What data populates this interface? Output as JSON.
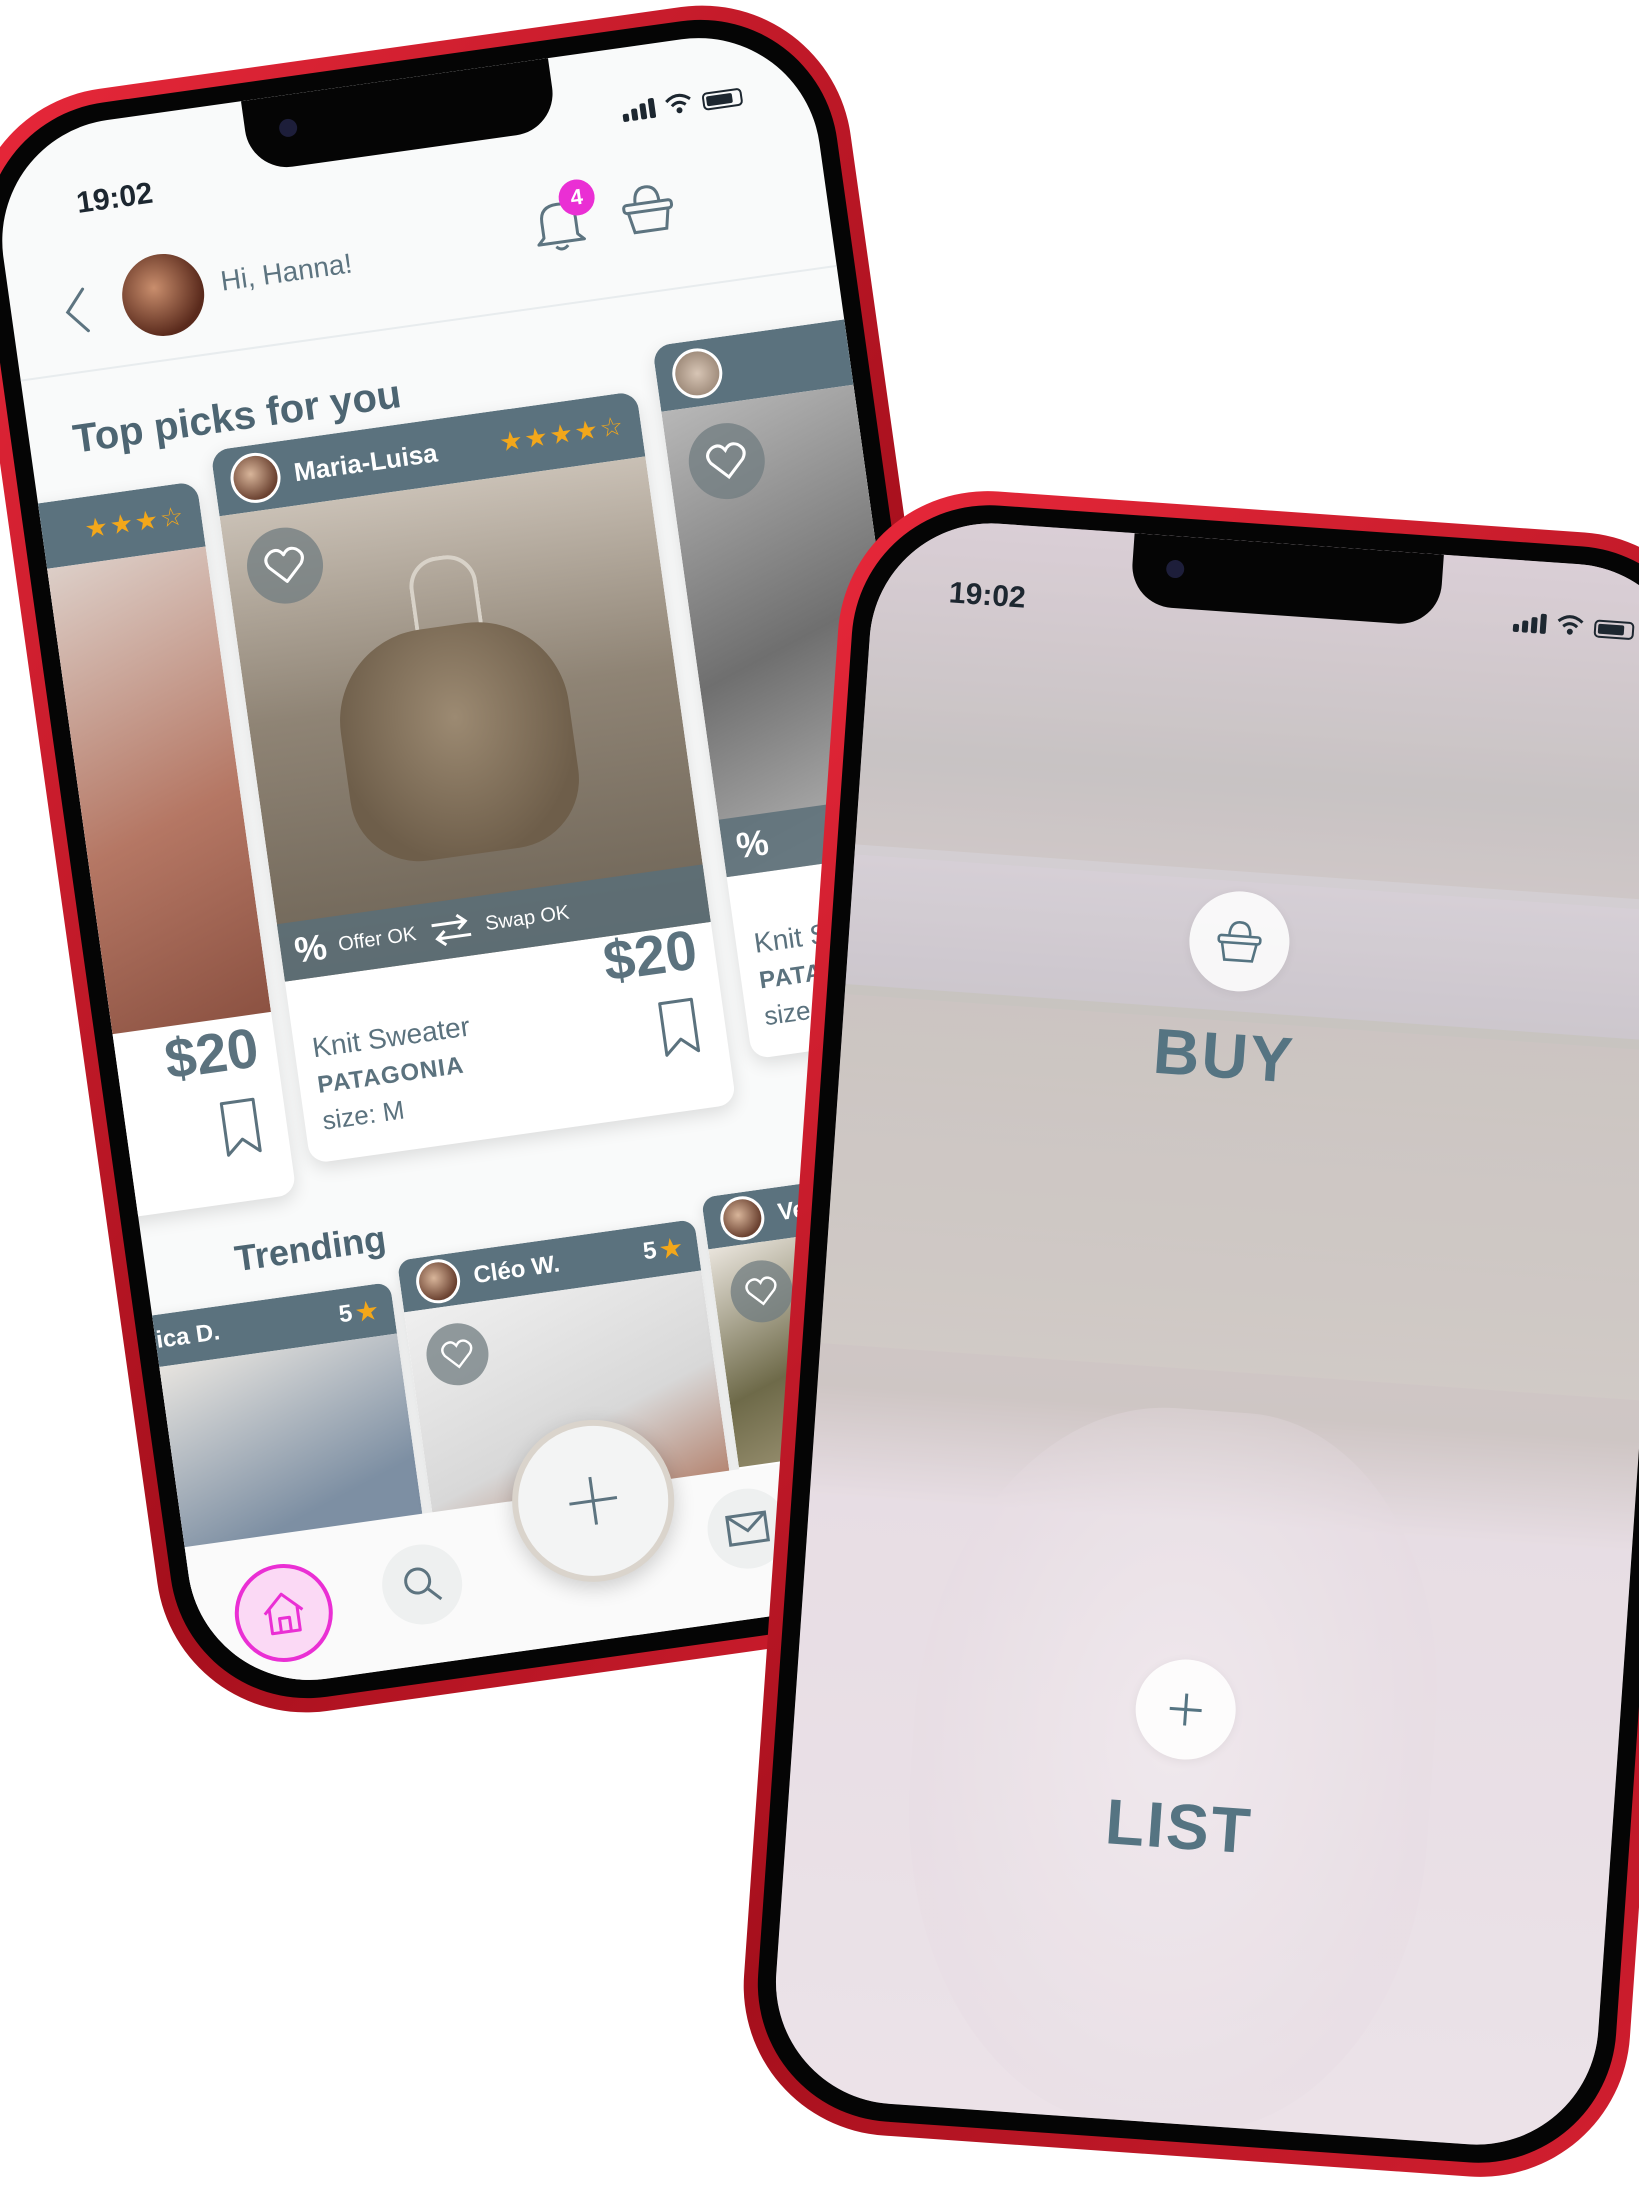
{
  "phone_a": {
    "status": {
      "time": "19:02"
    },
    "header": {
      "greeting": "Hi, Hanna!",
      "notification_count": "4"
    },
    "top_picks": {
      "title": "Top picks for you",
      "left_card": {
        "price": "$20",
        "rating": "★★★☆"
      },
      "main_card": {
        "seller": "Maria-Luisa",
        "rating": "★★★★☆",
        "offer_label": "Offer OK",
        "swap_label": "Swap OK",
        "item_name": "Knit Sweater",
        "brand": "PATAGONIA",
        "size": "size: M",
        "price": "$20"
      },
      "right_card": {
        "item_name": "Knit S",
        "brand": "PATA",
        "size": "size:"
      }
    },
    "trending": {
      "title": "Trending",
      "cards": [
        {
          "seller": "nica D.",
          "rating": "5"
        },
        {
          "seller": "Cléo W.",
          "rating": "5"
        },
        {
          "seller": "Veronic",
          "rating": ""
        }
      ]
    },
    "tabbar": {
      "items": [
        "home-icon",
        "search-icon",
        "add-icon",
        "mail-icon",
        "wardrobe-icon"
      ],
      "active_color": "#ea2fd4"
    }
  },
  "phone_b": {
    "status": {
      "time": "19:02"
    },
    "buy_label": "BUY",
    "list_label": "LIST",
    "accent": "#557482"
  }
}
